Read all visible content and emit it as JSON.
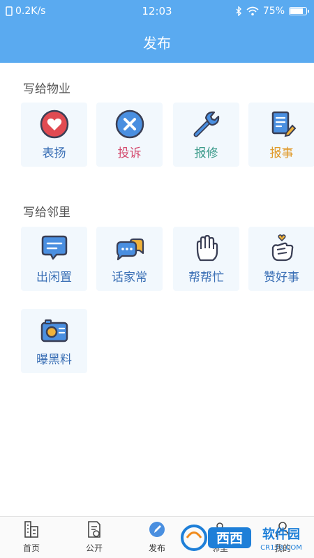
{
  "status_bar": {
    "speed": "0.2K/s",
    "time": "12:03",
    "battery": "75%",
    "battery_level": 0.75
  },
  "header": {
    "title": "发布"
  },
  "section_property": {
    "title": "写给物业",
    "items": [
      {
        "label": "表扬",
        "icon": "heart-icon",
        "color": "#3a6fb5"
      },
      {
        "label": "投诉",
        "icon": "close-circle-icon",
        "color": "#d44a6e"
      },
      {
        "label": "报修",
        "icon": "wrench-icon",
        "color": "#3a9a8a"
      },
      {
        "label": "报事",
        "icon": "note-edit-icon",
        "color": "#e09a2b"
      }
    ]
  },
  "section_neighbors": {
    "title": "写给邻里",
    "items": [
      {
        "label": "出闲置",
        "icon": "chat-bubble-icon",
        "color": "#3a6fb5"
      },
      {
        "label": "话家常",
        "icon": "chat-bubbles-icon",
        "color": "#3a6fb5"
      },
      {
        "label": "帮帮忙",
        "icon": "hand-icon",
        "color": "#3a6fb5"
      },
      {
        "label": "赞好事",
        "icon": "thumbs-up-heart-icon",
        "color": "#3a6fb5"
      },
      {
        "label": "曝黑料",
        "icon": "camera-icon",
        "color": "#3a6fb5"
      }
    ]
  },
  "tabbar": {
    "tabs": [
      {
        "label": "首页",
        "icon": "building-icon"
      },
      {
        "label": "公开",
        "icon": "document-icon"
      },
      {
        "label": "发布",
        "icon": "pen-icon",
        "active": true
      },
      {
        "label": "邻里",
        "icon": "people-icon"
      },
      {
        "label": "我的",
        "icon": "person-icon"
      }
    ]
  },
  "watermark": {
    "text": "西西",
    "sub": "软件园",
    "url": "CR173.COM"
  },
  "colors": {
    "brand": "#5aaaf0",
    "tile_bg": "#f2f8fd"
  }
}
